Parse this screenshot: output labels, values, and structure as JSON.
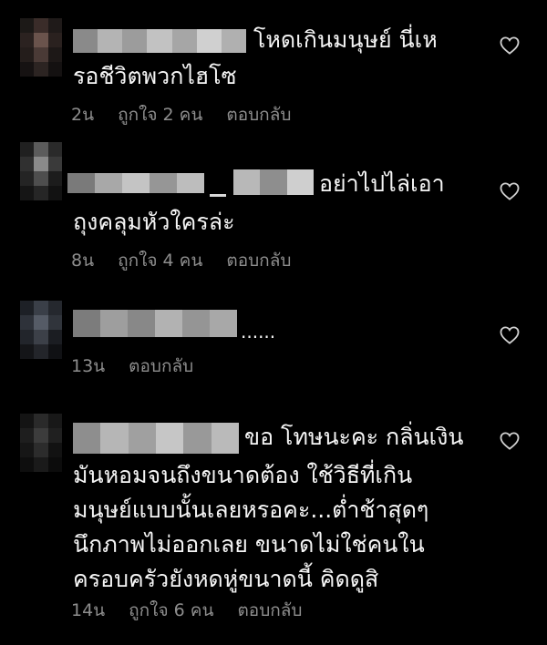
{
  "comments": [
    {
      "line1": "โหดเกินมนุษย์ นี่เห",
      "line2": "รอชีวิตพวกไฮโซ",
      "lines_extra": [],
      "time": "2น",
      "likes": "ถูกใจ 2 คน",
      "reply": "ตอบกลับ",
      "heart_icon": "heart-outline-icon"
    },
    {
      "line1": "อย่าไปไล่เอา",
      "line2": "ถุงคลุมหัวใครล่ะ",
      "lines_extra": [],
      "time": "8น",
      "likes": "ถูกใจ 4 คน",
      "reply": "ตอบกลับ",
      "heart_icon": "heart-outline-icon"
    },
    {
      "line1": "......",
      "time": "13น",
      "reply": "ตอบกลับ",
      "heart_icon": "heart-outline-icon"
    },
    {
      "line1": "ขอ โทษนะคะ กลิ่นเงิน",
      "line2": "มันหอมจนถึงขนาดต้อง ใช้วิธีที่เกิน",
      "line3": "มนุษย์แบบนั้นเลยหรอคะ...ต่ำช้าสุดๆ",
      "line4": "นึกภาพไม่ออกเลย ขนาดไม่ใช่คนใน",
      "line5": "ครอบครัวยังหดหู่ขนาดนี้ คิดดูสิ",
      "time": "14น",
      "likes": "ถูกใจ 6 คน",
      "reply": "ตอบกลับ",
      "heart_icon": "heart-outline-icon"
    }
  ],
  "colors": {
    "background": "#000000",
    "text": "#f5f5f5",
    "meta": "#8e8e8e",
    "heart": "#d0d0d0"
  }
}
